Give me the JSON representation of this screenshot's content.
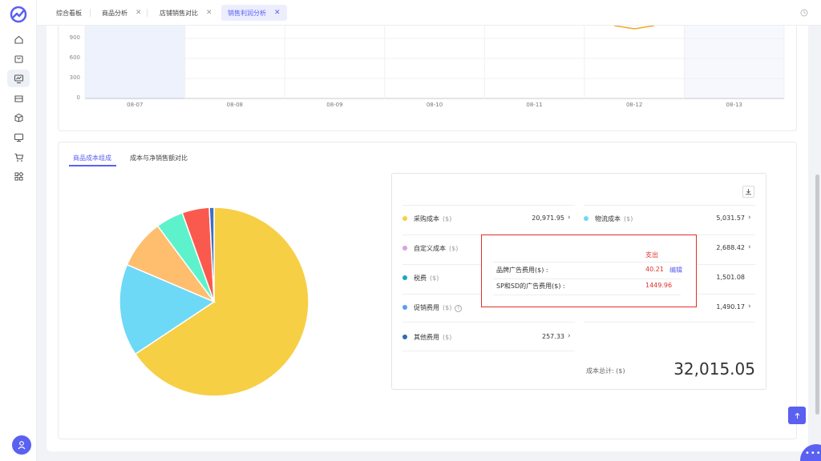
{
  "tabs": [
    {
      "label": "综合看板",
      "closable": false,
      "active": false
    },
    {
      "label": "商品分析",
      "closable": true,
      "active": false
    },
    {
      "label": "店铺销售对比",
      "closable": true,
      "active": false
    },
    {
      "label": "销售利润分析",
      "closable": true,
      "active": true
    }
  ],
  "close_glyph": "✕",
  "sidebar": {
    "icons": [
      "home-icon",
      "store-bag-icon",
      "sales-chart-icon",
      "shop-icon",
      "package-icon",
      "monitor-icon",
      "cart-icon",
      "apps-icon"
    ],
    "active_index": 2
  },
  "line_chart": {
    "y_ticks": [
      "900",
      "600",
      "300",
      "0"
    ],
    "x_ticks": [
      "08-07",
      "08-08",
      "08-09",
      "08-10",
      "08-11",
      "08-12",
      "08-13"
    ]
  },
  "sub_tabs": [
    "商品成本组成",
    "成本与净销售额对比"
  ],
  "costs": [
    {
      "label": "采购成本",
      "unit": "($)",
      "value": "20,971.95",
      "color": "#f7cf45",
      "chevron": true
    },
    {
      "label": "物流成本",
      "unit": "($)",
      "value": "5,031.57",
      "color": "#6ed8f7",
      "chevron": true
    },
    {
      "label": "自定义成本",
      "unit": "($)",
      "value": "",
      "color": "#d9a0e6",
      "chevron": false
    },
    {
      "label": "",
      "unit": "",
      "value": "2,688.42",
      "color": "",
      "chevron": true
    },
    {
      "label": "税费",
      "unit": "($)",
      "value": "",
      "color": "#1aa6c2",
      "chevron": false
    },
    {
      "label": "",
      "unit": "",
      "value": "1,501.08",
      "color": "",
      "chevron": false
    },
    {
      "label": "促销费用",
      "unit": "($)",
      "value": "",
      "color": "#5b9ef0",
      "chevron": false
    },
    {
      "label": "",
      "unit": "",
      "value": "1,490.17",
      "color": "",
      "chevron": true
    },
    {
      "label": "其他费用",
      "unit": "($)",
      "value": "257.33",
      "color": "#2f6db5",
      "chevron": true
    }
  ],
  "total": {
    "label": "成本总计: ($)",
    "value": "32,015.05"
  },
  "popup": {
    "header": "支出",
    "rows": [
      {
        "label": "品牌广告费用($) :",
        "value": "40.21"
      },
      {
        "label": "SP和SD的广告费用($) :",
        "value": "1449.96"
      }
    ],
    "edit_label": "编辑"
  },
  "chart_data": {
    "type": "pie",
    "title": "",
    "slices": [
      {
        "label": "采购成本",
        "value": 20971.95,
        "color": "#f7cf45"
      },
      {
        "label": "物流成本",
        "value": 5031.57,
        "color": "#6ed8f7"
      },
      {
        "label": "",
        "value": 2688.42,
        "color": "#ffbd6e"
      },
      {
        "label": "",
        "value": 1501.08,
        "color": "#5df2cc"
      },
      {
        "label": "",
        "value": 1490.17,
        "color": "#fa5a4e"
      },
      {
        "label": "其他费用",
        "value": 257.33,
        "color": "#3a6fc4"
      }
    ]
  }
}
